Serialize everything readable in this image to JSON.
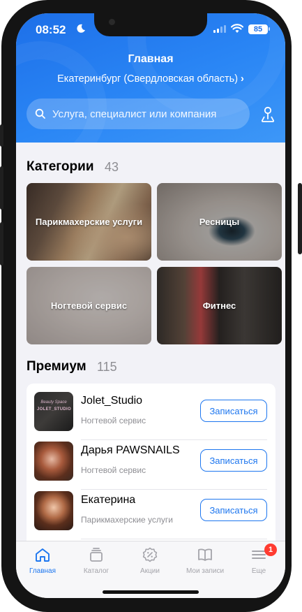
{
  "status_bar": {
    "time": "08:52",
    "battery": "85"
  },
  "header": {
    "title": "Главная",
    "location": "Екатеринбург (Свердловская область)",
    "location_chevron": "›"
  },
  "search": {
    "placeholder": "Услуга, специалист или компания",
    "value": ""
  },
  "categories": {
    "title": "Категории",
    "count": "43",
    "items": [
      {
        "label": "Парикмахерские услуги"
      },
      {
        "label": "Ресницы"
      },
      {
        "label": "Ногтевой сервис"
      },
      {
        "label": "Фитнес"
      }
    ]
  },
  "premium": {
    "title": "Премиум",
    "count": "115",
    "items": [
      {
        "name": "Jolet_Studio",
        "category": "Ногтевой сервис",
        "button": "Записаться",
        "avatar_script": "Beauty Space",
        "avatar_text": "JOLET_STUDIO"
      },
      {
        "name": "Дарья PAWSNAILS",
        "category": "Ногтевой сервис",
        "button": "Записаться"
      },
      {
        "name": "Екатерина",
        "category": "Парикмахерские услуги",
        "button": "Записаться"
      }
    ]
  },
  "tabbar": {
    "items": [
      {
        "label": "Главная",
        "active": true
      },
      {
        "label": "Каталог"
      },
      {
        "label": "Акции"
      },
      {
        "label": "Мои записи"
      },
      {
        "label": "Еще",
        "badge": "1"
      }
    ]
  },
  "colors": {
    "accent": "#1d76ef",
    "header": "#2a86f5",
    "badge": "#ff3b30"
  }
}
